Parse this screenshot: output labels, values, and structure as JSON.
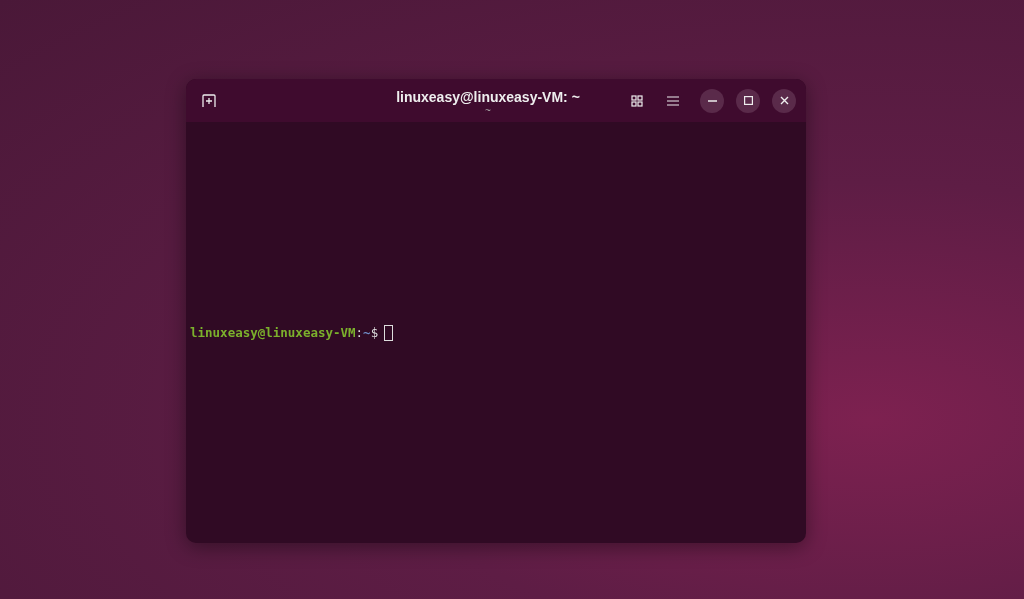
{
  "window": {
    "title": "linuxeasy@linuxeasy-VM: ~",
    "subtitle": "~"
  },
  "terminal": {
    "prompt": {
      "user_host": "linuxeasy@linuxeasy-VM",
      "separator": ":",
      "path": "~",
      "symbol": "$"
    }
  }
}
